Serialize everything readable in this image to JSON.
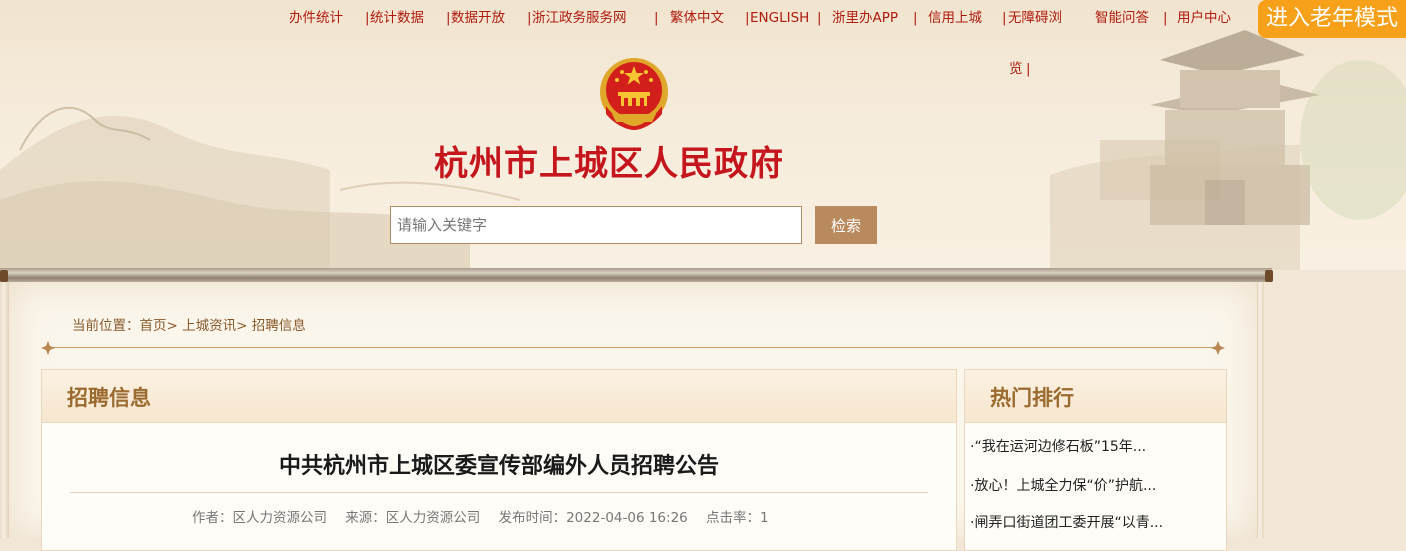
{
  "topnav": {
    "items": [
      "办件统计",
      "统计数据",
      "数据开放",
      "浙江政务服务网",
      "繁体中文",
      "ENGLISH",
      "浙里办APP",
      "信用上城",
      "无障碍浏",
      "智能问答",
      "用户中心"
    ],
    "overflow": "览",
    "separator": "|"
  },
  "elder_mode": "进入老年模式",
  "site_title": "杭州市上城区人民政府",
  "search": {
    "placeholder": "请输入关键字",
    "button": "检索"
  },
  "breadcrumb": {
    "label": "当前位置：",
    "items": [
      "首页",
      "上城资讯",
      "招聘信息"
    ],
    "arrow": ">"
  },
  "main": {
    "section_title": "招聘信息",
    "article": {
      "title": "中共杭州市上城区委宣传部编外人员招聘公告",
      "author": "作者：区人力资源公司",
      "source": "来源：区人力资源公司",
      "published": "发布时间：2022-04-06 16:26",
      "clicks": "点击率：1"
    }
  },
  "sidebar": {
    "title": "热门排行",
    "items": [
      "·“我在运河边修石板”15年...",
      "·放心！上城全力保“价”护航...",
      "·闸弄口街道团工委开展“以青..."
    ]
  },
  "colors": {
    "nav_red": "#b01b10",
    "title_red": "#c4161c",
    "elder_orange": "#f7a11a",
    "button_brown": "#b98a5e",
    "section_brown": "#9a6a2e"
  }
}
